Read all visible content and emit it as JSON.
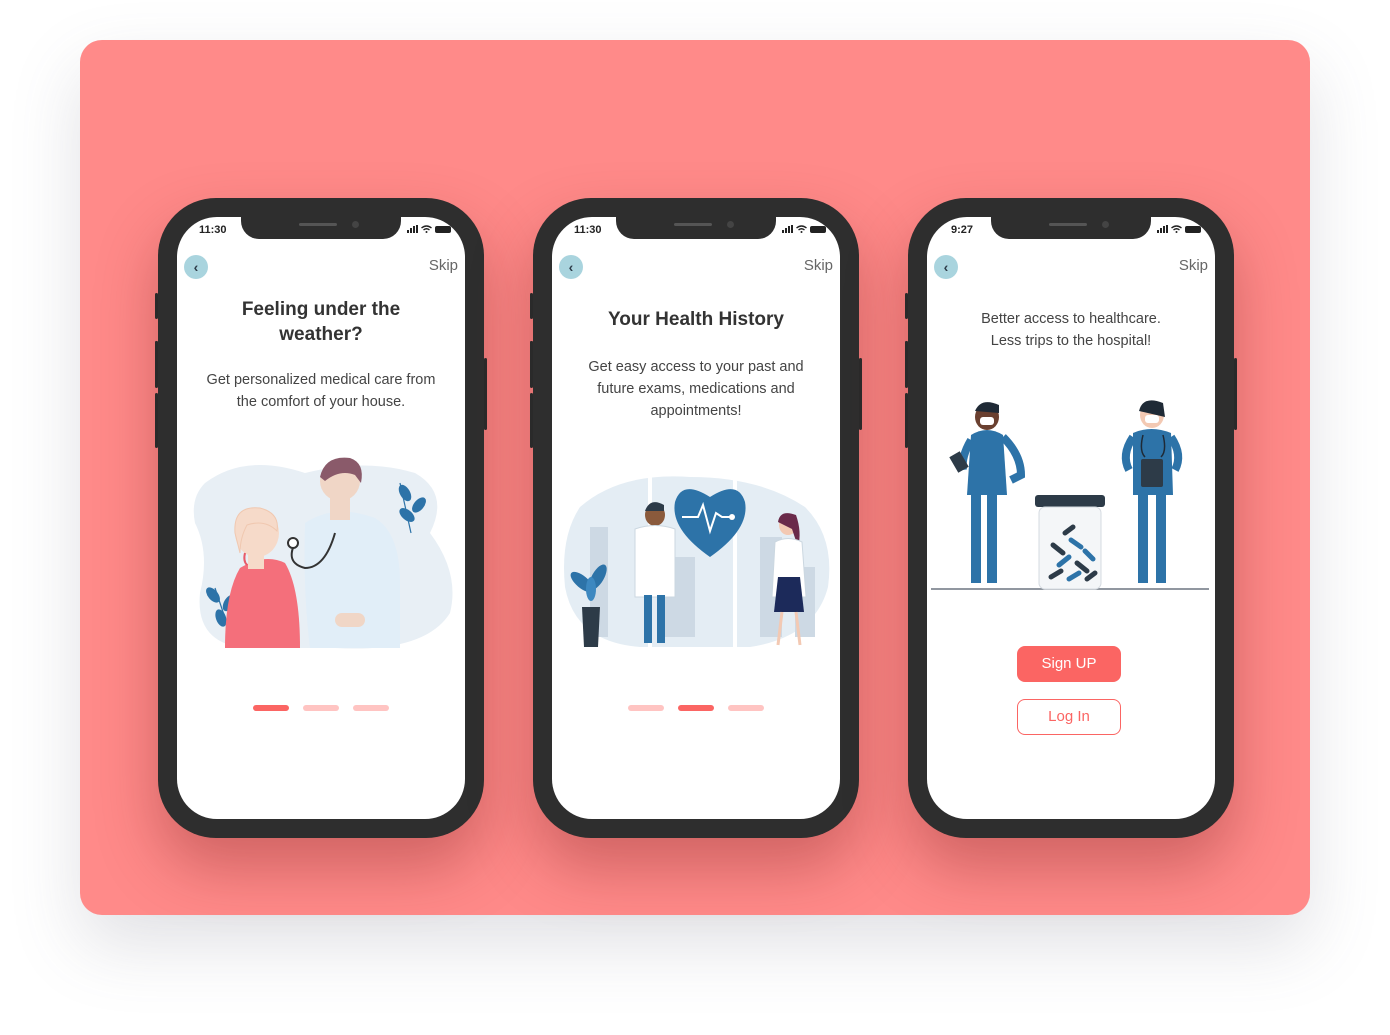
{
  "colors": {
    "background_card": "#ff8a89",
    "accent": "#fb6563",
    "accent_light": "#ffc4c2",
    "medical_blue": "#2d73a8",
    "back_button": "#a9d4de"
  },
  "phones": [
    {
      "time": "11:30",
      "back_icon": "chevron-left-icon",
      "skip_label": "Skip",
      "title": "Feeling under the weather?",
      "subtitle": "Get personalized  medical care from the comfort of your house.",
      "active_dot": 0
    },
    {
      "time": "11:30",
      "back_icon": "chevron-left-icon",
      "skip_label": "Skip",
      "title": "Your Health History",
      "subtitle": "Get easy access to your past and future exams, medications and appointments!",
      "active_dot": 1
    },
    {
      "time": "9:27",
      "back_icon": "chevron-left-icon",
      "skip_label": "Skip",
      "subtitle": "Better access to healthcare. Less trips to the hospital!",
      "signup_label": "Sign UP",
      "login_label": "Log In"
    }
  ]
}
